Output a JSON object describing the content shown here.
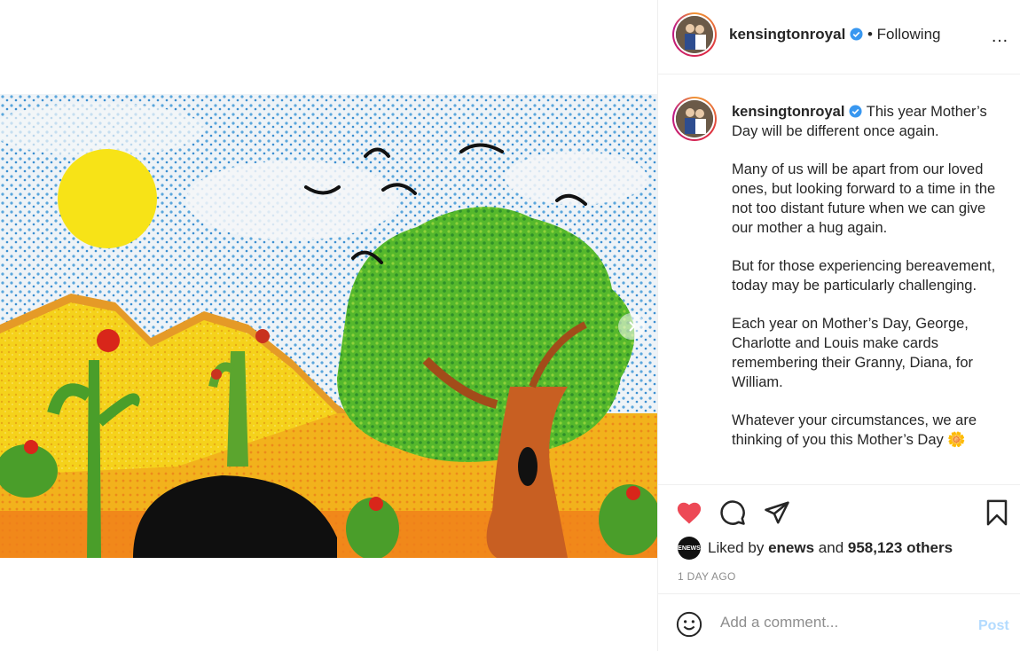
{
  "post": {
    "image_alt": "Child's crayon drawing of yellow hills, cactus, a green tree, sun and birds"
  },
  "header": {
    "username": "kensingtonroyal",
    "follow_status": "• Following",
    "more_icon": "…"
  },
  "caption": {
    "username": "kensingtonroyal",
    "lead": "This year Mother’s Day will be different once again.",
    "paragraphs": [
      "Many of us will be apart from our loved ones, but looking forward to a time in the not too distant future when we can give our mother a hug again.",
      "But for those experiencing bereavement, today may be particularly challenging.",
      "Each year on Mother’s Day, George, Charlotte and Louis make cards remembering their Granny, Diana, for William.",
      "Whatever your circumstances, we are thinking of you this Mother’s Day 🌼"
    ]
  },
  "likes": {
    "avatar_text": "ENEWS",
    "prefix": "Liked by ",
    "first_user": "enews",
    "middle": " and ",
    "count_text": "958,123 others"
  },
  "timestamp": "1 DAY AGO",
  "comment": {
    "placeholder": "Add a comment...",
    "post_label": "Post"
  },
  "colors": {
    "like_red": "#ed4956",
    "verified_blue": "#3897f0",
    "post_disabled": "#b3dbff"
  }
}
